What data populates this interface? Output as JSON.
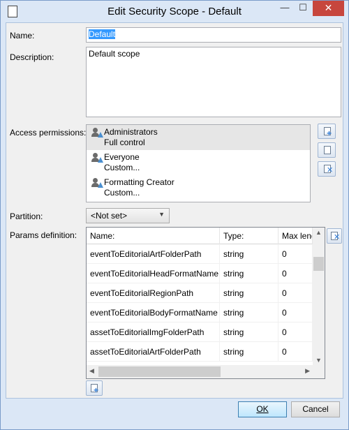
{
  "window": {
    "title": "Edit Security Scope - Default",
    "minimize_glyph": "—",
    "maximize_glyph": "☐",
    "close_glyph": "✕"
  },
  "form": {
    "name_label": "Name:",
    "name_value": "Default",
    "description_label": "Description:",
    "description_value": "Default scope",
    "access_label": "Access permissions:",
    "partition_label": "Partition:",
    "partition_value": "<Not set>",
    "params_label": "Params definition:"
  },
  "permissions": [
    {
      "name": "Administrators",
      "level": "Full control",
      "selected": true
    },
    {
      "name": "Everyone",
      "level": "Custom..."
    },
    {
      "name": "Formatting Creator",
      "level": "Custom..."
    }
  ],
  "params": {
    "columns": [
      "Name:",
      "Type:",
      "Max leng"
    ],
    "rows": [
      {
        "name": "eventToEditorialArtFolderPath",
        "type": "string",
        "max": "0"
      },
      {
        "name": "eventToEditorialHeadFormatName",
        "type": "string",
        "max": "0"
      },
      {
        "name": "eventToEditorialRegionPath",
        "type": "string",
        "max": "0"
      },
      {
        "name": "eventToEditorialBodyFormatName",
        "type": "string",
        "max": "0"
      },
      {
        "name": "assetToEditorialImgFolderPath",
        "type": "string",
        "max": "0"
      },
      {
        "name": "assetToEditorialArtFolderPath",
        "type": "string",
        "max": "0"
      }
    ]
  },
  "buttons": {
    "ok": "OK",
    "cancel": "Cancel"
  },
  "icons": {
    "title": "window-icon",
    "add": "add-icon",
    "edit": "edit-icon",
    "delete": "delete-icon"
  }
}
